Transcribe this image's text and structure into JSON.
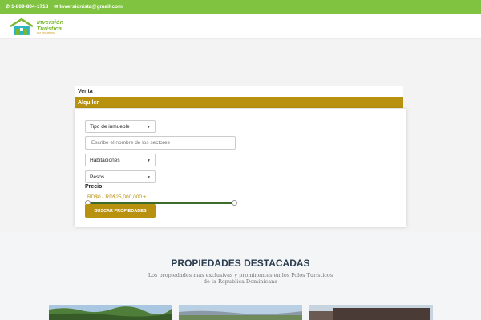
{
  "topbar": {
    "phone": "1-809-804-1718",
    "email": "Inversionista@gmail.com",
    "bg_color": "#80c341"
  },
  "brand": {
    "name": "Inversión Turística",
    "tagline": "por inmuebles",
    "primary_color": "#7cb82f",
    "accent_color": "#b8920e"
  },
  "tabs": [
    {
      "label": "Venta",
      "active": false
    },
    {
      "label": "Alquiler",
      "active": true
    }
  ],
  "search": {
    "property_type": "Tipo de inmueble",
    "sector_placeholder": "Escribe el nombre de los sectores",
    "rooms": "Habitaciones",
    "currency": "Pesos",
    "price_label": "Precio:",
    "price_range": "RD$0 - RD$25,000,000 +",
    "button_label": "BUSCAR PROPIEDADES"
  },
  "featured": {
    "title": "PROPIEDADES DESTACADAS",
    "subtitle": "Los propiedades más exclusivas y prominentes en los Polos Turísticos de la Republica Dominicana"
  },
  "icons": {
    "phone": "phone-icon",
    "email": "envelope-icon",
    "caret": "chevron-down-icon"
  }
}
